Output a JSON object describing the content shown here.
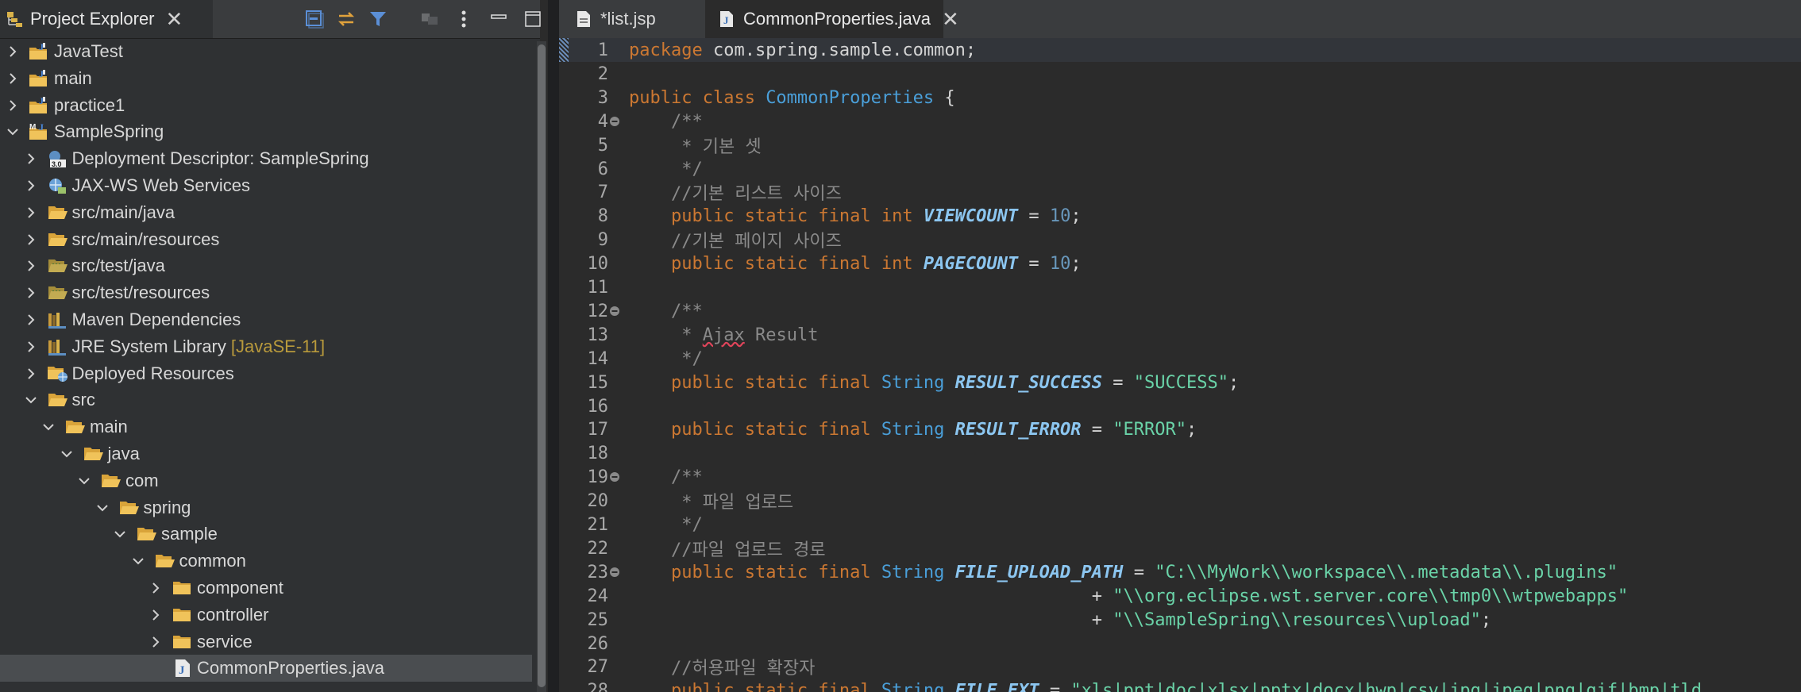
{
  "explorer": {
    "title": "Project Explorer",
    "toolbar": [
      "collapse-all-icon",
      "link-with-editor-icon",
      "filter-icon",
      "focus-icon",
      "view-menu-icon",
      "minimize-icon",
      "maximize-icon"
    ],
    "items": [
      {
        "label": "JavaTest",
        "decor": "",
        "depth": 0,
        "expanded": false,
        "icon": "java-project-icon",
        "selected": false
      },
      {
        "label": "main",
        "decor": "",
        "depth": 0,
        "expanded": false,
        "icon": "java-project-icon",
        "selected": false
      },
      {
        "label": "practice1",
        "decor": "",
        "depth": 0,
        "expanded": false,
        "icon": "java-project-icon",
        "selected": false
      },
      {
        "label": "SampleSpring",
        "decor": "",
        "depth": 0,
        "expanded": true,
        "icon": "maven-project-icon",
        "selected": false
      },
      {
        "label": "Deployment Descriptor: SampleSpring",
        "decor": "",
        "depth": 1,
        "expanded": false,
        "icon": "deployment-descriptor-icon",
        "selected": false
      },
      {
        "label": "JAX-WS Web Services",
        "decor": "",
        "depth": 1,
        "expanded": false,
        "icon": "web-services-icon",
        "selected": false
      },
      {
        "label": "src/main/java",
        "decor": "",
        "depth": 1,
        "expanded": false,
        "icon": "source-folder-icon",
        "selected": false
      },
      {
        "label": "src/main/resources",
        "decor": "",
        "depth": 1,
        "expanded": false,
        "icon": "source-folder-icon",
        "selected": false
      },
      {
        "label": "src/test/java",
        "decor": "",
        "depth": 1,
        "expanded": false,
        "icon": "test-folder-icon",
        "selected": false
      },
      {
        "label": "src/test/resources",
        "decor": "",
        "depth": 1,
        "expanded": false,
        "icon": "test-folder-icon",
        "selected": false
      },
      {
        "label": "Maven Dependencies",
        "decor": "",
        "depth": 1,
        "expanded": false,
        "icon": "library-icon",
        "selected": false
      },
      {
        "label": "JRE System Library",
        "decor": "[JavaSE-11]",
        "depth": 1,
        "expanded": false,
        "icon": "library-icon",
        "selected": false
      },
      {
        "label": "Deployed Resources",
        "decor": "",
        "depth": 1,
        "expanded": false,
        "icon": "deployed-resources-icon",
        "selected": false
      },
      {
        "label": "src",
        "decor": "",
        "depth": 1,
        "expanded": true,
        "icon": "folder-open-icon",
        "selected": false
      },
      {
        "label": "main",
        "decor": "",
        "depth": 2,
        "expanded": true,
        "icon": "folder-open-icon",
        "selected": false
      },
      {
        "label": "java",
        "decor": "",
        "depth": 3,
        "expanded": true,
        "icon": "folder-open-icon",
        "selected": false
      },
      {
        "label": "com",
        "decor": "",
        "depth": 4,
        "expanded": true,
        "icon": "folder-open-icon",
        "selected": false
      },
      {
        "label": "spring",
        "decor": "",
        "depth": 5,
        "expanded": true,
        "icon": "folder-open-icon",
        "selected": false
      },
      {
        "label": "sample",
        "decor": "",
        "depth": 6,
        "expanded": true,
        "icon": "folder-open-icon",
        "selected": false
      },
      {
        "label": "common",
        "decor": "",
        "depth": 7,
        "expanded": true,
        "icon": "folder-open-icon",
        "selected": false
      },
      {
        "label": "component",
        "decor": "",
        "depth": 8,
        "expanded": false,
        "icon": "folder-icon",
        "selected": false
      },
      {
        "label": "controller",
        "decor": "",
        "depth": 8,
        "expanded": false,
        "icon": "folder-icon",
        "selected": false
      },
      {
        "label": "service",
        "decor": "",
        "depth": 8,
        "expanded": false,
        "icon": "folder-icon",
        "selected": false
      },
      {
        "label": "CommonProperties.java",
        "decor": "",
        "depth": 8,
        "leaf": true,
        "icon": "java-file-icon",
        "selected": true
      }
    ]
  },
  "editor": {
    "tabs": [
      {
        "label": "*list.jsp",
        "icon": "jsp-file-icon",
        "active": false
      },
      {
        "label": "CommonProperties.java",
        "icon": "java-file-icon",
        "active": true
      }
    ],
    "current_line": 1,
    "lines": [
      {
        "n": "1",
        "fold": false,
        "parts": [
          [
            "kw",
            "package"
          ],
          [
            "",
            " com.spring.sample.common;"
          ]
        ]
      },
      {
        "n": "2",
        "fold": false,
        "parts": []
      },
      {
        "n": "3",
        "fold": false,
        "parts": [
          [
            "kw",
            "public class "
          ],
          [
            "ty",
            "CommonProperties"
          ],
          [
            "",
            " {"
          ]
        ]
      },
      {
        "n": "4",
        "fold": true,
        "parts": [
          [
            "",
            "    "
          ],
          [
            "cm",
            "/**"
          ]
        ]
      },
      {
        "n": "5",
        "fold": false,
        "parts": [
          [
            "",
            "    "
          ],
          [
            "cm",
            " * 기본 셋"
          ]
        ]
      },
      {
        "n": "6",
        "fold": false,
        "parts": [
          [
            "",
            "    "
          ],
          [
            "cm",
            " */"
          ]
        ]
      },
      {
        "n": "7",
        "fold": false,
        "parts": [
          [
            "",
            "    "
          ],
          [
            "cm",
            "//기본 리스트 사이즈"
          ]
        ]
      },
      {
        "n": "8",
        "fold": false,
        "parts": [
          [
            "",
            "    "
          ],
          [
            "kw",
            "public static final int "
          ],
          [
            "cn",
            "VIEWCOUNT"
          ],
          [
            "",
            " = "
          ],
          [
            "num",
            "10"
          ],
          [
            "",
            ";"
          ]
        ]
      },
      {
        "n": "9",
        "fold": false,
        "parts": [
          [
            "",
            "    "
          ],
          [
            "cm",
            "//기본 페이지 사이즈"
          ]
        ]
      },
      {
        "n": "10",
        "fold": false,
        "parts": [
          [
            "",
            "    "
          ],
          [
            "kw",
            "public static final int "
          ],
          [
            "cn",
            "PAGECOUNT"
          ],
          [
            "",
            " = "
          ],
          [
            "num",
            "10"
          ],
          [
            "",
            ";"
          ]
        ]
      },
      {
        "n": "11",
        "fold": false,
        "parts": []
      },
      {
        "n": "12",
        "fold": true,
        "parts": [
          [
            "",
            "    "
          ],
          [
            "cm",
            "/**"
          ]
        ]
      },
      {
        "n": "13",
        "fold": false,
        "parts": [
          [
            "",
            "    "
          ],
          [
            "cm",
            " * "
          ],
          [
            "cm err",
            "Ajax"
          ],
          [
            "cm",
            " Result"
          ]
        ]
      },
      {
        "n": "14",
        "fold": false,
        "parts": [
          [
            "",
            "    "
          ],
          [
            "cm",
            " */"
          ]
        ]
      },
      {
        "n": "15",
        "fold": false,
        "parts": [
          [
            "",
            "    "
          ],
          [
            "kw",
            "public static final "
          ],
          [
            "ty",
            "String "
          ],
          [
            "cn",
            "RESULT_SUCCESS"
          ],
          [
            "",
            " = "
          ],
          [
            "str",
            "\"SUCCESS\""
          ],
          [
            "",
            ";"
          ]
        ]
      },
      {
        "n": "16",
        "fold": false,
        "parts": []
      },
      {
        "n": "17",
        "fold": false,
        "parts": [
          [
            "",
            "    "
          ],
          [
            "kw",
            "public static final "
          ],
          [
            "ty",
            "String "
          ],
          [
            "cn",
            "RESULT_ERROR"
          ],
          [
            "",
            " = "
          ],
          [
            "str",
            "\"ERROR\""
          ],
          [
            "",
            ";"
          ]
        ]
      },
      {
        "n": "18",
        "fold": false,
        "parts": []
      },
      {
        "n": "19",
        "fold": true,
        "parts": [
          [
            "",
            "    "
          ],
          [
            "cm",
            "/**"
          ]
        ]
      },
      {
        "n": "20",
        "fold": false,
        "parts": [
          [
            "",
            "    "
          ],
          [
            "cm",
            " * 파일 업로드"
          ]
        ]
      },
      {
        "n": "21",
        "fold": false,
        "parts": [
          [
            "",
            "    "
          ],
          [
            "cm",
            " */"
          ]
        ]
      },
      {
        "n": "22",
        "fold": false,
        "parts": [
          [
            "",
            "    "
          ],
          [
            "cm",
            "//파일 업로드 경로"
          ]
        ]
      },
      {
        "n": "23",
        "fold": true,
        "parts": [
          [
            "",
            "    "
          ],
          [
            "kw",
            "public static final "
          ],
          [
            "ty",
            "String "
          ],
          [
            "cn",
            "FILE_UPLOAD_PATH"
          ],
          [
            "",
            " = "
          ],
          [
            "str",
            "\"C:\\\\MyWork\\\\workspace\\\\.metadata\\\\.plugins\""
          ]
        ]
      },
      {
        "n": "24",
        "fold": false,
        "parts": [
          [
            "",
            "                                            + "
          ],
          [
            "str",
            "\"\\\\org.eclipse.wst.server.core\\\\tmp0\\\\wtpwebapps\""
          ]
        ]
      },
      {
        "n": "25",
        "fold": false,
        "parts": [
          [
            "",
            "                                            + "
          ],
          [
            "str",
            "\"\\\\SampleSpring\\\\resources\\\\upload\""
          ],
          [
            "",
            ";"
          ]
        ]
      },
      {
        "n": "26",
        "fold": false,
        "parts": []
      },
      {
        "n": "27",
        "fold": false,
        "parts": [
          [
            "",
            "    "
          ],
          [
            "cm",
            "//허용파일 확장자"
          ]
        ]
      },
      {
        "n": "28",
        "fold": false,
        "parts": [
          [
            "",
            "    "
          ],
          [
            "kw",
            "public static final "
          ],
          [
            "ty",
            "String "
          ],
          [
            "cn",
            "FILE_EXT"
          ],
          [
            "",
            " = "
          ],
          [
            "str",
            "\"xls|ppt|doc|xlsx|pptx|docx|hwp|csv|jpg|jpeg|png|gif|bmp|tld"
          ]
        ]
      }
    ]
  },
  "colors": {
    "keyword": "#cc7832",
    "type": "#4a9fd9",
    "constant": "#8cc6f0",
    "number": "#6897bb",
    "string": "#6ad3a8",
    "comment": "#8a8a8a",
    "decorator": "#b99a3c"
  }
}
